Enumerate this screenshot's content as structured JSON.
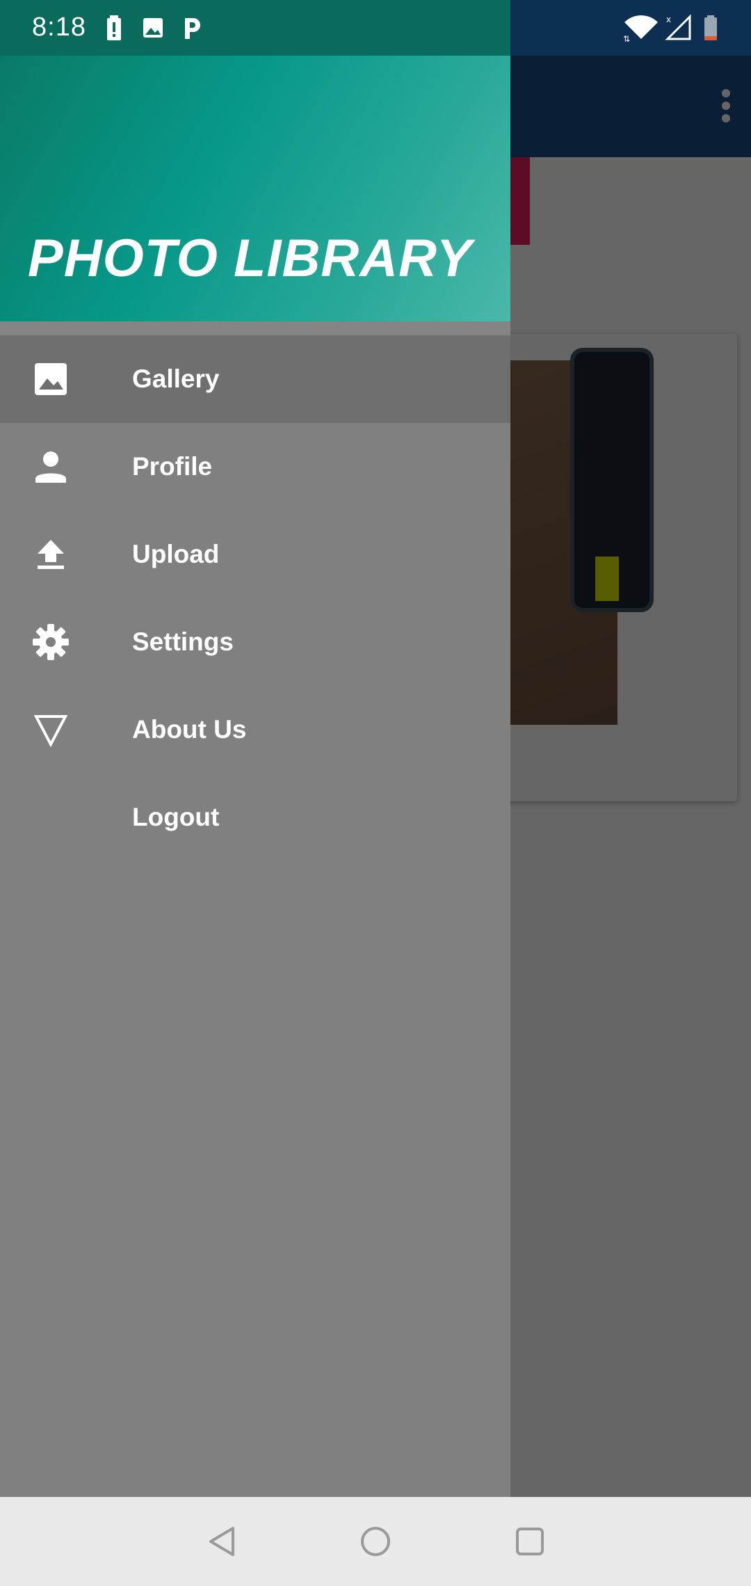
{
  "status_bar": {
    "time": "8:18",
    "left_icons": [
      "battery-alert-icon",
      "image-icon",
      "p-app-icon"
    ],
    "right_icons": [
      "wifi-icon",
      "cell-signal-icon",
      "battery-low-icon"
    ],
    "battery_color": "#e05a3a"
  },
  "drawer": {
    "title": "PHOTO LIBRARY",
    "header_colors": [
      "#0a7a68",
      "#4ab8ab"
    ],
    "items": [
      {
        "label": "Gallery",
        "icon": "image-icon",
        "active": true
      },
      {
        "label": "Profile",
        "icon": "person-icon",
        "active": false
      },
      {
        "label": "Upload",
        "icon": "upload-icon",
        "active": false
      },
      {
        "label": "Settings",
        "icon": "gear-icon",
        "active": false
      },
      {
        "label": "About Us",
        "icon": "triangle-icon",
        "active": false
      },
      {
        "label": "Logout",
        "icon": "",
        "active": false
      }
    ]
  },
  "app": {
    "toolbar_color": "#1a4f86",
    "accent_color": "#e91e63",
    "overflow_icon": "more-vert-icon"
  },
  "nav_bar": {
    "buttons": [
      "back-icon",
      "home-icon",
      "recents-icon"
    ]
  }
}
